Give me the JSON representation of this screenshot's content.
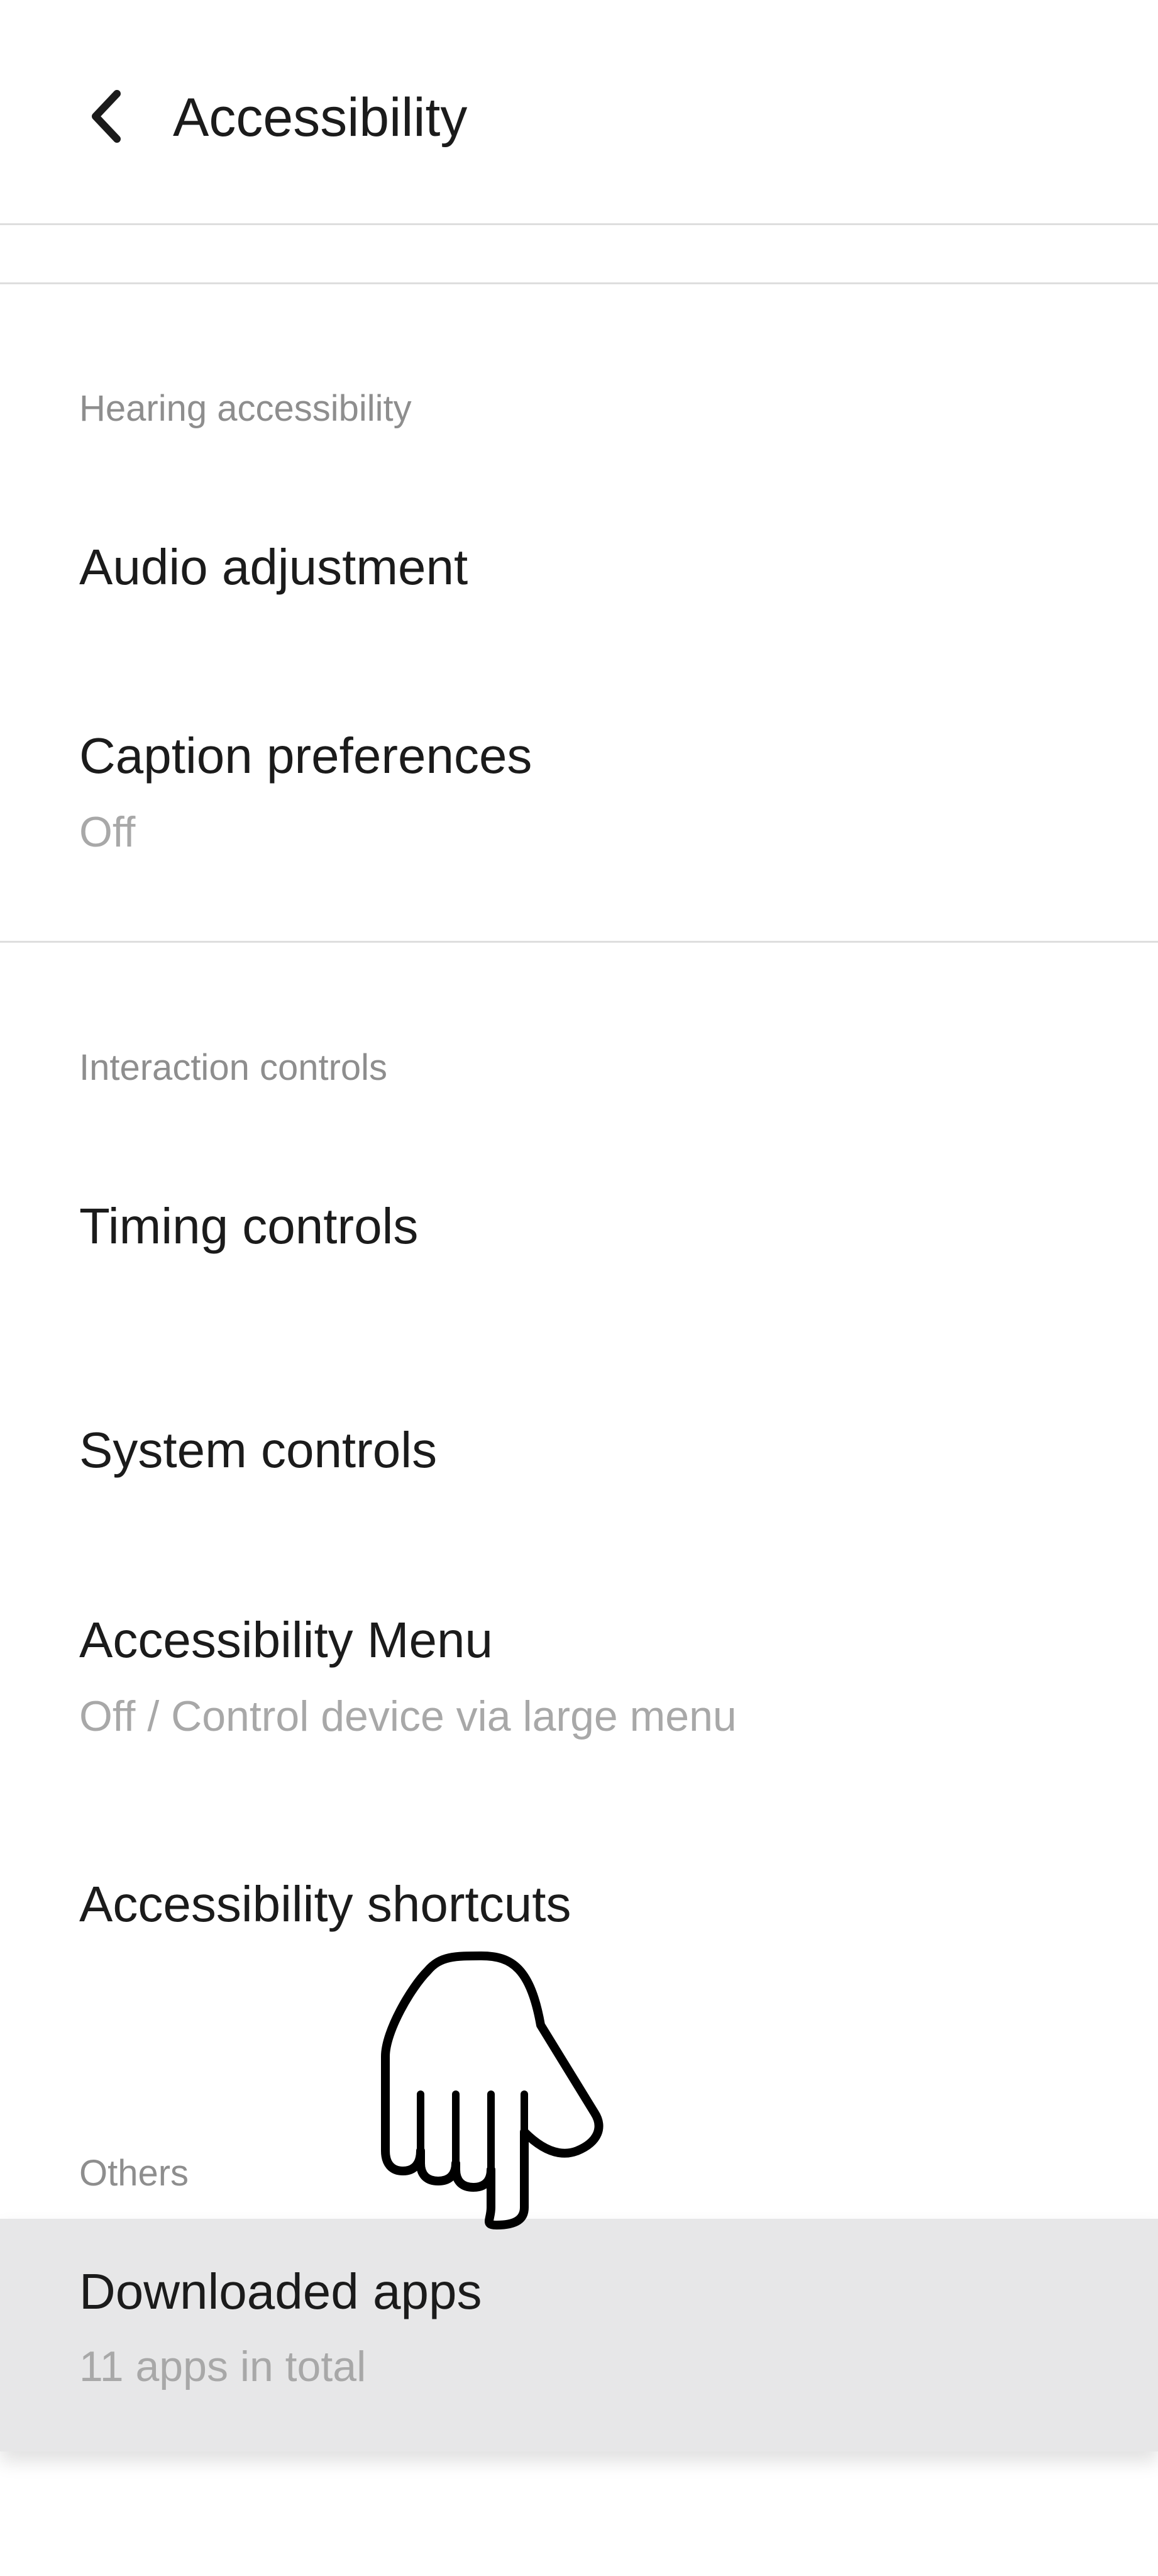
{
  "header": {
    "title": "Accessibility",
    "back_icon": "chevron-left-icon"
  },
  "sections": {
    "hearing": {
      "label": "Hearing accessibility",
      "items": [
        {
          "title": "Audio adjustment"
        },
        {
          "title": "Caption preferences",
          "subtitle": "Off"
        }
      ]
    },
    "interaction": {
      "label": "Interaction controls",
      "items": [
        {
          "title": "Timing controls"
        },
        {
          "title": "System controls"
        },
        {
          "title": "Accessibility Menu",
          "subtitle": "Off / Control device via large menu"
        },
        {
          "title": "Accessibility shortcuts"
        }
      ]
    },
    "others": {
      "label": "Others",
      "items": [
        {
          "title": "Downloaded apps",
          "subtitle": "11 apps in total"
        }
      ]
    }
  },
  "overlay": {
    "pointer_icon": "pointing-hand-icon"
  },
  "colors": {
    "background": "#ffffff",
    "primary_text": "#1b1b1b",
    "secondary_text": "#a8a8a8",
    "section_label": "#8e8e8e",
    "divider": "#dedede",
    "highlight_row": "#e7e7e8"
  }
}
